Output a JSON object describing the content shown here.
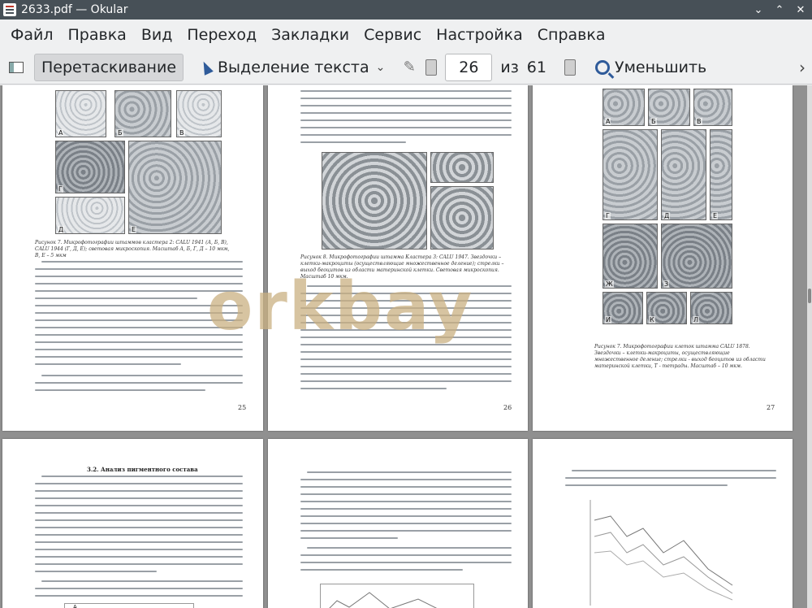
{
  "window": {
    "title": "2633.pdf — Okular",
    "buttons": {
      "minimize": "⌄",
      "maximize": "⌃",
      "close": "✕"
    }
  },
  "menu": [
    "Файл",
    "Правка",
    "Вид",
    "Переход",
    "Закладки",
    "Сервис",
    "Настройка",
    "Справка"
  ],
  "toolbar": {
    "drag_label": "Перетаскивание",
    "text_select_label": "Выделение текста",
    "current_page": "26",
    "of_label": "из",
    "total_pages": "61",
    "zoom_out_label": "Уменьшить",
    "overflow": "›"
  },
  "watermark": "orkbay",
  "pages": {
    "p25": {
      "number": "25",
      "caption": "Рисунок 7. Микрофотографии штаммов кластера 2: CALU 1941 (А, Б, В), CALU 1944 (Г, Д, Е); световая микроскопия. Масштаб А, Б, Г, Д – 10 мкм, В, Е – 5 мкм",
      "photo_labels": [
        "А",
        "Б",
        "В",
        "Г",
        "Е",
        "Д"
      ]
    },
    "p26": {
      "number": "26",
      "caption": "Рисунок 8. Микрофотографии штамма Кластера 3: CALU 1947. Звездочки – клетки-макроциты (осуществляющие множественное деление); стрелки – выход беоцитов из области материнской клетки. Световая микроскопия. Масштаб 10 мкм."
    },
    "p27": {
      "number": "27",
      "caption": "Рисунок 7. Микрофотографии клеток штамма CALU 1878. Звездочки – клетки-макроциты, осуществляющие множественное деление; стрелки - выход беоцитов из области материнской клетки, Т - тетрады. Масштаб – 10 мкм.",
      "photo_labels": [
        "А",
        "Б",
        "В",
        "Г",
        "Д",
        "Е",
        "Ж",
        "З",
        "И",
        "К",
        "Л"
      ]
    },
    "p28": {
      "heading": "3.2. Анализ пигментного состава",
      "chart_label": "А"
    }
  }
}
